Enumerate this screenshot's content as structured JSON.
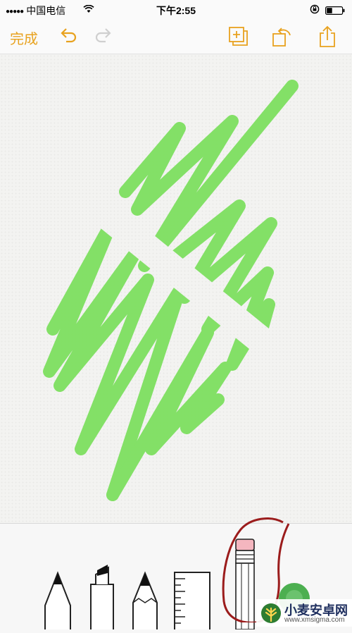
{
  "status": {
    "carrier": "中国电信",
    "time": "下午2:55",
    "icons": [
      "signal-dots-icon",
      "wifi-icon",
      "rotation-lock-icon",
      "battery-icon"
    ]
  },
  "toolbar": {
    "done_label": "完成",
    "icons": [
      "undo-icon",
      "redo-icon",
      "add-page-icon",
      "rotate-icon",
      "share-icon"
    ]
  },
  "canvas": {
    "stroke_color": "#7ee060"
  },
  "tools": {
    "items": [
      "pen",
      "marker",
      "pencil",
      "ruler",
      "eraser"
    ],
    "selected": "eraser",
    "color_picker_color": "#4caf50",
    "annotation_color": "#9b1c1c"
  },
  "watermark": {
    "title": "小麦安卓网",
    "url": "www.xmsigma.com"
  },
  "colors": {
    "accent": "#e8a21f"
  }
}
